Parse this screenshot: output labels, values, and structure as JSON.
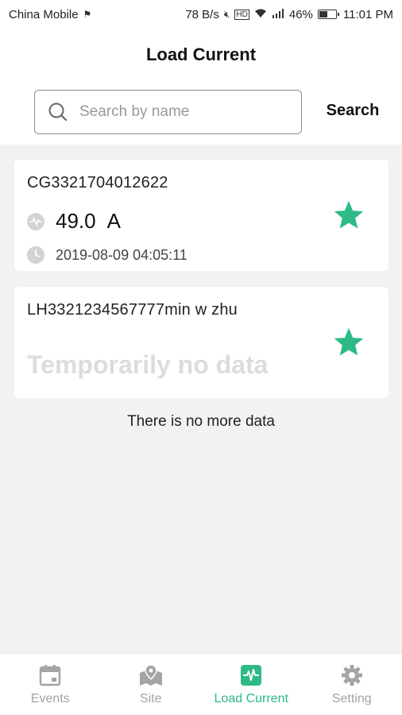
{
  "status_bar": {
    "carrier": "China Mobile",
    "speed": "78 B/s",
    "battery": "46%",
    "battery_level": 0.46,
    "time": "11:01 PM"
  },
  "header": {
    "title": "Load Current",
    "search": {
      "placeholder": "Search by name",
      "value": "",
      "button_label": "Search"
    }
  },
  "devices": [
    {
      "name": "CG3321704012622",
      "value": "49.0",
      "unit": "A",
      "timestamp": "2019-08-09 04:05:11",
      "favorite": true
    },
    {
      "name": "LH3321234567777min w zhu",
      "no_data_text": "Temporarily no data",
      "favorite": true
    }
  ],
  "footer_text": "There is no more data",
  "tabs": [
    {
      "label": "Events",
      "icon": "calendar-icon",
      "active": false
    },
    {
      "label": "Site",
      "icon": "map-pin-icon",
      "active": false
    },
    {
      "label": "Load Current",
      "icon": "pulse-icon",
      "active": true
    },
    {
      "label": "Setting",
      "icon": "gear-icon",
      "active": false
    }
  ],
  "colors": {
    "accent": "#2dba85",
    "inactive": "#a4a4a4",
    "background": "#f2f2f2"
  }
}
